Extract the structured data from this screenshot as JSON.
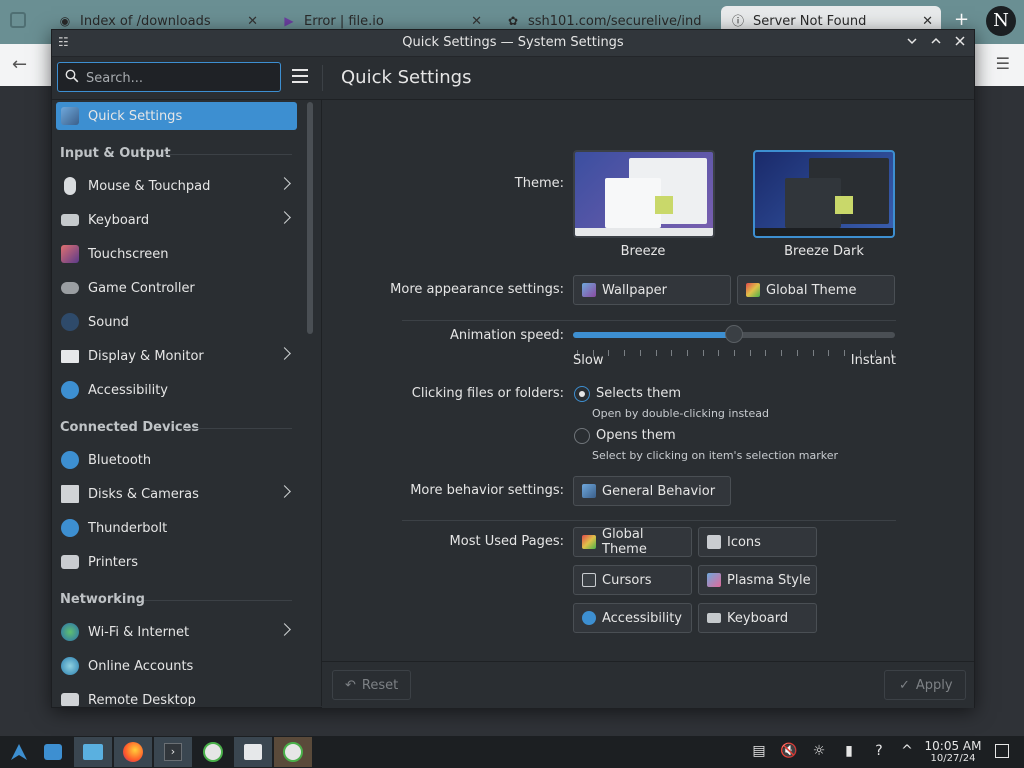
{
  "browser": {
    "tabs": [
      {
        "title": "Index of /downloads"
      },
      {
        "title": "Error | file.io"
      },
      {
        "title": "ssh101.com/securelive/ind"
      },
      {
        "title": "Server Not Found"
      }
    ],
    "profile_letter": "N"
  },
  "window": {
    "title": "Quick Settings — System Settings"
  },
  "header": {
    "search_placeholder": "Search...",
    "page_title": "Quick Settings"
  },
  "sidebar": {
    "active": "Quick Settings",
    "sections": [
      {
        "heading": "Input & Output",
        "items": [
          {
            "label": "Mouse & Touchpad",
            "chevron": true
          },
          {
            "label": "Keyboard",
            "chevron": true
          },
          {
            "label": "Touchscreen",
            "chevron": false
          },
          {
            "label": "Game Controller",
            "chevron": false
          },
          {
            "label": "Sound",
            "chevron": false
          },
          {
            "label": "Display & Monitor",
            "chevron": true
          },
          {
            "label": "Accessibility",
            "chevron": false
          }
        ]
      },
      {
        "heading": "Connected Devices",
        "items": [
          {
            "label": "Bluetooth",
            "chevron": false
          },
          {
            "label": "Disks & Cameras",
            "chevron": true
          },
          {
            "label": "Thunderbolt",
            "chevron": false
          },
          {
            "label": "Printers",
            "chevron": false
          }
        ]
      },
      {
        "heading": "Networking",
        "items": [
          {
            "label": "Wi-Fi & Internet",
            "chevron": true
          },
          {
            "label": "Online Accounts",
            "chevron": false
          },
          {
            "label": "Remote Desktop",
            "chevron": false
          }
        ]
      }
    ]
  },
  "main": {
    "theme_label": "Theme:",
    "themes": [
      {
        "name": "Breeze",
        "selected": false
      },
      {
        "name": "Breeze Dark",
        "selected": true
      }
    ],
    "appearance_label": "More appearance settings:",
    "appearance_buttons": [
      "Wallpaper",
      "Global Theme"
    ],
    "animation_label": "Animation speed:",
    "animation_value": 0.5,
    "animation_min": "Slow",
    "animation_max": "Instant",
    "clicking_label": "Clicking files or folders:",
    "click_options": [
      {
        "label": "Selects them",
        "hint": "Open by double-clicking instead",
        "checked": true
      },
      {
        "label": "Opens them",
        "hint": "Select by clicking on item's selection marker",
        "checked": false
      }
    ],
    "behavior_label": "More behavior settings:",
    "behavior_button": "General Behavior",
    "most_used_label": "Most Used Pages:",
    "most_used": [
      "Global Theme",
      "Icons",
      "Cursors",
      "Plasma Style",
      "Accessibility",
      "Keyboard"
    ]
  },
  "footer": {
    "reset": "Reset",
    "apply": "Apply"
  },
  "taskbar": {
    "time": "10:05 AM",
    "date": "10/27/24"
  },
  "colors": {
    "accent": "#3d8fd1",
    "window_bg": "#2a2e32",
    "text": "#e6e6e6"
  }
}
